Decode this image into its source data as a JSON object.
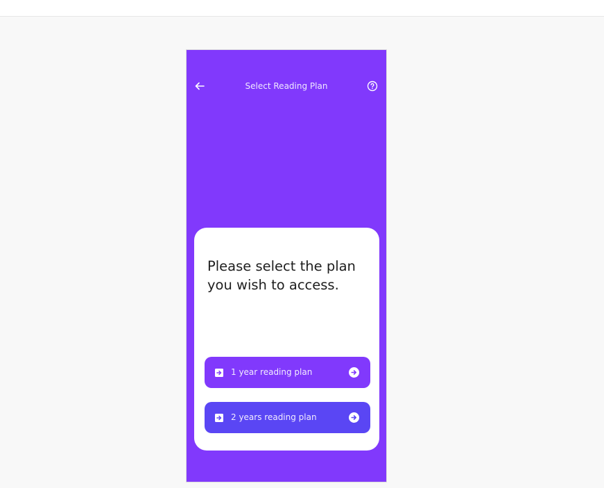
{
  "header": {
    "title": "Select Reading Plan",
    "back_icon": "arrow-left-icon",
    "help_icon": "question-circle-icon"
  },
  "card": {
    "prompt": "Please select the plan you wish to access."
  },
  "plans": [
    {
      "label": "1 year reading plan",
      "color": "#8139fc",
      "icon": "login-icon",
      "arrow_icon": "arrow-right-circle-icon"
    },
    {
      "label": "2 years reading plan",
      "color": "#5a46f4",
      "icon": "login-icon",
      "arrow_icon": "arrow-right-circle-icon"
    }
  ],
  "colors": {
    "primary": "#8139fc",
    "secondary": "#5a46f4",
    "background": "#f8f8f8",
    "card": "#ffffff"
  }
}
